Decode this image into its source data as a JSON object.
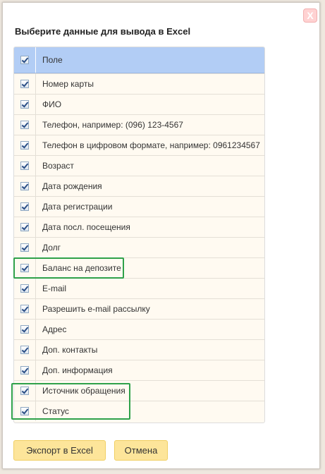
{
  "dialog": {
    "title": "Выберите данные для вывода в Excel",
    "close_label": "X"
  },
  "table": {
    "header_label": "Поле",
    "header_checked": true,
    "rows": [
      {
        "label": "Номер карты",
        "checked": true
      },
      {
        "label": "ФИО",
        "checked": true
      },
      {
        "label": "Телефон, например: (096) 123-4567",
        "checked": true
      },
      {
        "label": "Телефон в цифровом формате, например: 0961234567",
        "checked": true
      },
      {
        "label": "Возраст",
        "checked": true
      },
      {
        "label": "Дата рождения",
        "checked": true
      },
      {
        "label": "Дата регистрации",
        "checked": true
      },
      {
        "label": "Дата посл. посещения",
        "checked": true
      },
      {
        "label": "Долг",
        "checked": true
      },
      {
        "label": "Баланс на депозите",
        "checked": true
      },
      {
        "label": "E-mail",
        "checked": true
      },
      {
        "label": "Разрешить e-mail рассылку",
        "checked": true
      },
      {
        "label": "Адрес",
        "checked": true
      },
      {
        "label": "Доп. контакты",
        "checked": true
      },
      {
        "label": "Доп. информация",
        "checked": true
      },
      {
        "label": "Источник обращения",
        "checked": true
      },
      {
        "label": "Статус",
        "checked": true
      }
    ]
  },
  "buttons": {
    "export_label": "Экспорт в Excel",
    "cancel_label": "Отмена"
  },
  "colors": {
    "header_bg": "#b2cdf5",
    "row_bg": "#fffaf1",
    "button_bg": "#fde59a",
    "highlight": "#2fa14a",
    "close_bg": "#ffd2d2"
  }
}
